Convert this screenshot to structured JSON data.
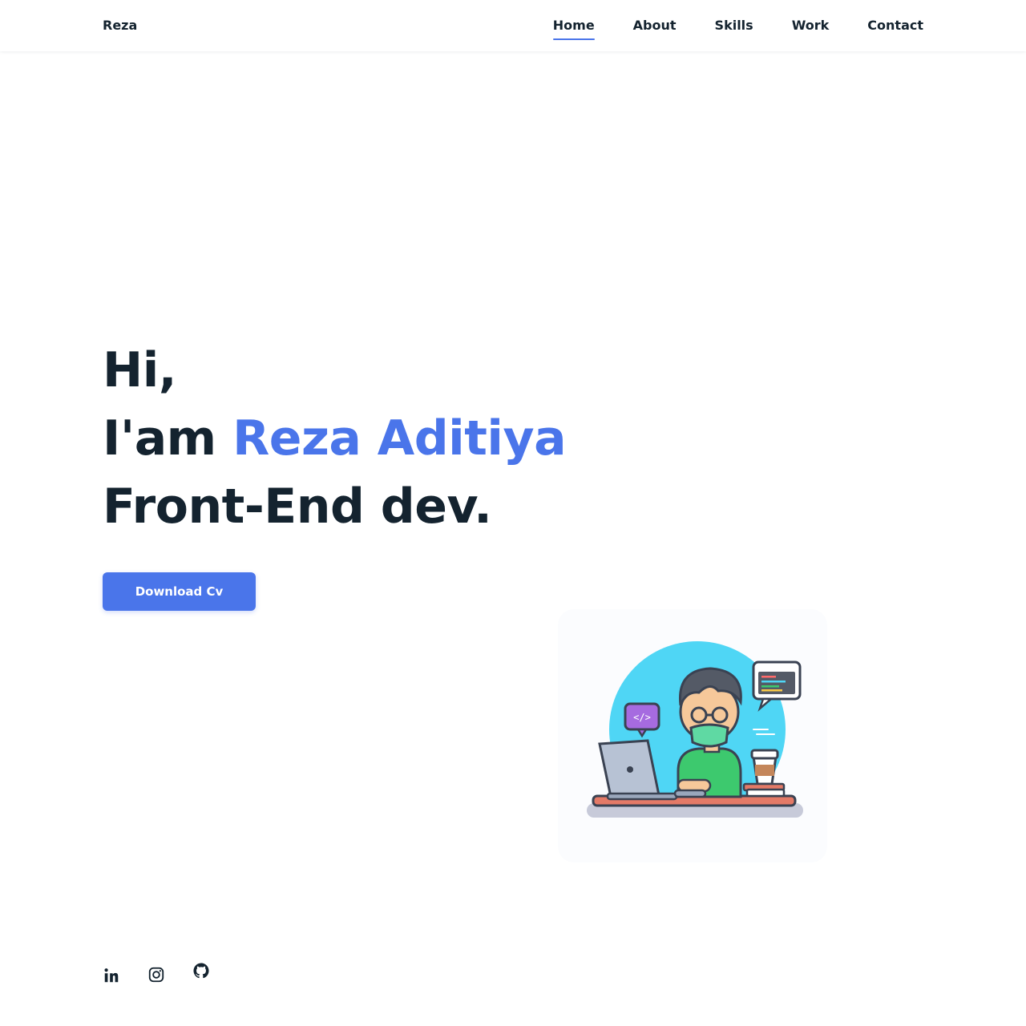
{
  "header": {
    "logo": "Reza",
    "nav": [
      {
        "label": "Home",
        "active": true
      },
      {
        "label": "About",
        "active": false
      },
      {
        "label": "Skills",
        "active": false
      },
      {
        "label": "Work",
        "active": false
      },
      {
        "label": "Contact",
        "active": false
      }
    ]
  },
  "hero": {
    "line1": "Hi,",
    "line2_prefix": "I'am ",
    "line2_name": "Reza Aditiya",
    "line3": "Front-End dev.",
    "button_label": "Download Cv",
    "illustration_icon": "developer-at-laptop-illustration"
  },
  "social": [
    {
      "icon": "linkedin-icon"
    },
    {
      "icon": "instagram-icon"
    },
    {
      "icon": "github-icon"
    }
  ],
  "colors": {
    "accent": "#4a75ea",
    "text": "#14232f",
    "background": "#ffffff"
  }
}
